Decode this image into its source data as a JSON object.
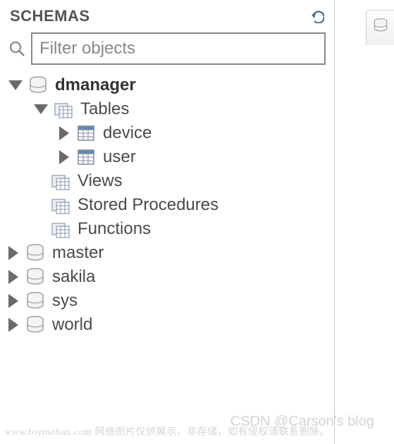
{
  "panel": {
    "title": "SCHEMAS"
  },
  "search": {
    "placeholder": "Filter objects",
    "value": ""
  },
  "schemas": {
    "dmanager": {
      "label": "dmanager",
      "folders": {
        "tables": {
          "label": "Tables",
          "items": [
            {
              "label": "device"
            },
            {
              "label": "user"
            }
          ]
        },
        "views": {
          "label": "Views"
        },
        "stored_procedures": {
          "label": "Stored Procedures"
        },
        "functions": {
          "label": "Functions"
        }
      }
    },
    "master": {
      "label": "master"
    },
    "sakila": {
      "label": "sakila"
    },
    "sys": {
      "label": "sys"
    },
    "world": {
      "label": "world"
    }
  },
  "watermark": {
    "left": "www.toymoban.com 网络图片仅供展示，非存储，如有侵权请联系删除。",
    "right": "CSDN @Carson's  blog"
  }
}
